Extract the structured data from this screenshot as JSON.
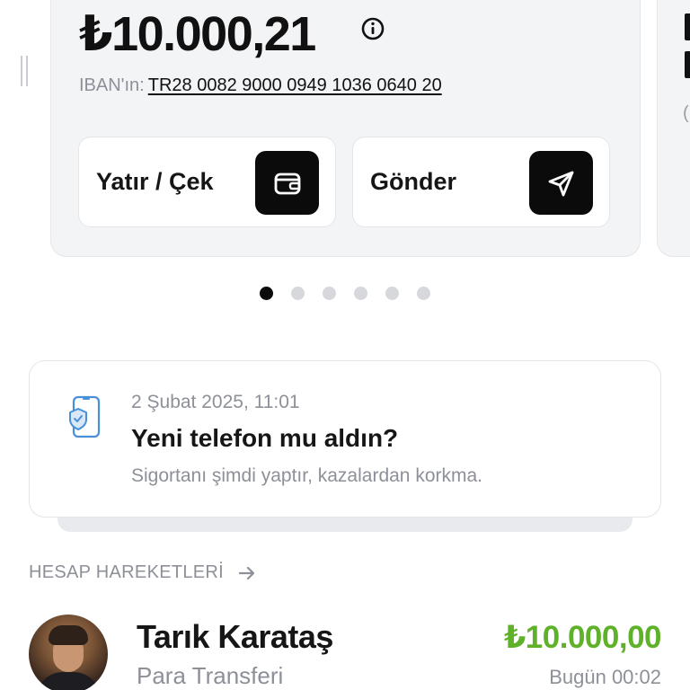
{
  "balance": {
    "amount": "₺10.000,21",
    "iban_label": "IBAN'ın:",
    "iban_value": "TR28 0082 9000 0949 1036 0640 20"
  },
  "actions": {
    "deposit_label": "Yatır / Çek",
    "send_label": "Gönder"
  },
  "next_card": {
    "partial_text": "("
  },
  "carousel": {
    "count": 6,
    "active_index": 0
  },
  "notification": {
    "date": "2 Şubat 2025, 11:01",
    "title": "Yeni telefon mu aldın?",
    "body": "Sigortanı şimdi yaptır, kazalardan korkma."
  },
  "transactions_section": {
    "title": "HESAP HAREKETLERİ"
  },
  "transactions": [
    {
      "name": "Tarık Karataş",
      "type": "Para Transferi",
      "amount": "₺10.000,00",
      "time": "Bugün 00:02"
    }
  ],
  "colors": {
    "accent_black": "#0b0b0b",
    "incoming_green": "#5fb12a",
    "muted_text": "#8d9098",
    "card_bg": "#f3f4f6",
    "notification_icon": "#4a90d9"
  },
  "icons": {
    "info": "info-icon",
    "wallet": "wallet-icon",
    "send": "send-icon",
    "phone_shield": "phone-shield-icon",
    "arrow": "arrow-right-icon"
  }
}
